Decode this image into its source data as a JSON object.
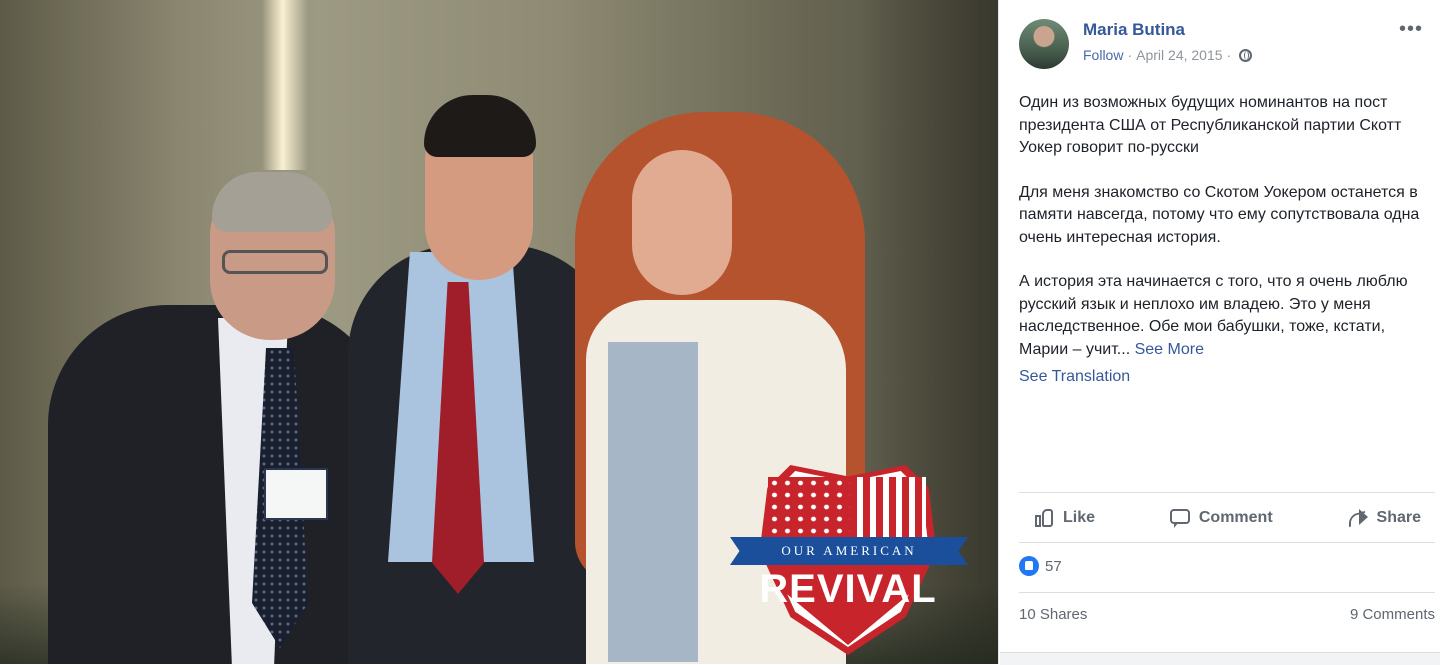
{
  "photo": {
    "badge": {
      "ribbon": "OUR AMERICAN",
      "main": "REVIVAL"
    }
  },
  "post": {
    "author": "Maria Butina",
    "follow_label": "Follow",
    "separator": "·",
    "date": "April 24, 2015",
    "visibility_icon": "globe-icon",
    "more_icon": "more-options-icon",
    "paragraphs": [
      "Один из возможных будущих номинантов на пост президента США от Республиканской партии Скотт Уокер говорит по-русски",
      "Для меня знакомство со Скотом Уокером останется в памяти навсегда, потому что ему сопутствовала одна очень интересная история.",
      "А история эта начинается с того, что я очень люблю русский язык и неплохо им владею. Это у меня наследственное. Обе мои бабушки, тоже, кстати, Марии – учит..."
    ],
    "see_more": "See More",
    "see_translation": "See Translation"
  },
  "actions": {
    "like": "Like",
    "comment": "Comment",
    "share": "Share"
  },
  "stats": {
    "reactions_count": "57",
    "shares": "10 Shares",
    "comments": "9 Comments"
  },
  "colors": {
    "link": "#365899",
    "text": "#1d2129",
    "muted": "#606770",
    "like_blue": "#2078f4",
    "badge_red": "#c8242b",
    "badge_blue": "#1b4f9c"
  }
}
